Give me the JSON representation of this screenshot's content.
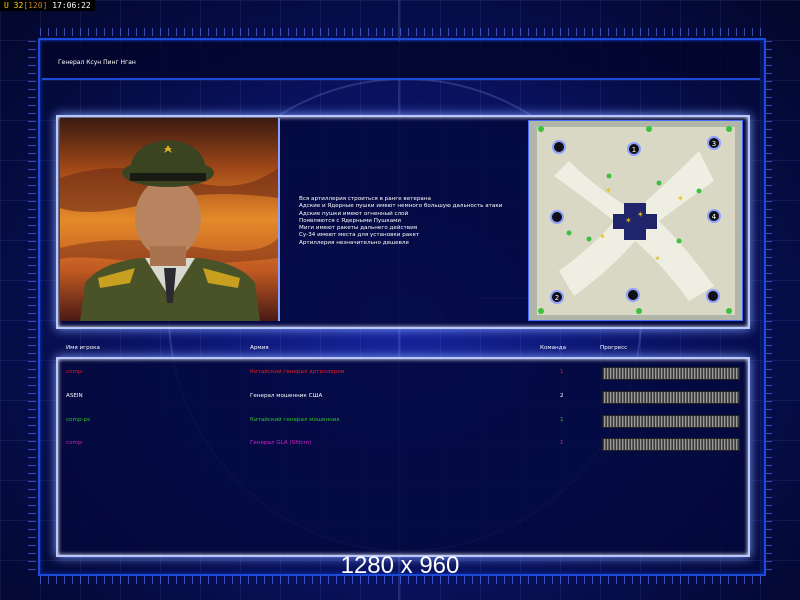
{
  "hud": {
    "prefix": "U",
    "fps": "32",
    "fps_max": "[120]",
    "clock": "17:06:22"
  },
  "title": "Генерал Ксун Пинг Нган",
  "description": [
    "Вся артиллерия строиться в ранге ветерана",
    "Адские и Ядерные пушки имеют немного большую дальность атаки",
    "Адские пушки имеют огненный слой",
    "Появляются с Ядерными Пушками",
    "Миги имеют ракеты дальнего действия",
    "Су-34 имеют места для установки ракет",
    "Артиллерия незначительно дешевле"
  ],
  "columns": {
    "player": "Имя игрока",
    "army": "Армия",
    "team": "Команда",
    "progress": "Прогресс"
  },
  "players": [
    {
      "name": "comp-",
      "army": "Китайский генерал артиллерии",
      "team": "1",
      "color": "#e02020",
      "progress": 1.0
    },
    {
      "name": "ASEIN",
      "army": "Генерал мошенник США",
      "team": "2",
      "color": "#ffffff",
      "progress": 1.0
    },
    {
      "name": "comp-ps",
      "army": "Китайский генерал мошенник",
      "team": "1",
      "color": "#30c030",
      "progress": 1.0
    },
    {
      "name": "comp-",
      "army": "Генерал GLA (Sfdcm)",
      "team": "1",
      "color": "#d020c0",
      "progress": 1.0
    }
  ],
  "map_slots": [
    "1",
    "2",
    "3",
    "4"
  ],
  "watermark": "1280 x 960",
  "colors": {
    "frame": "#1b4bd8",
    "glow": "#b8c8ff",
    "background": "#0d1670"
  }
}
